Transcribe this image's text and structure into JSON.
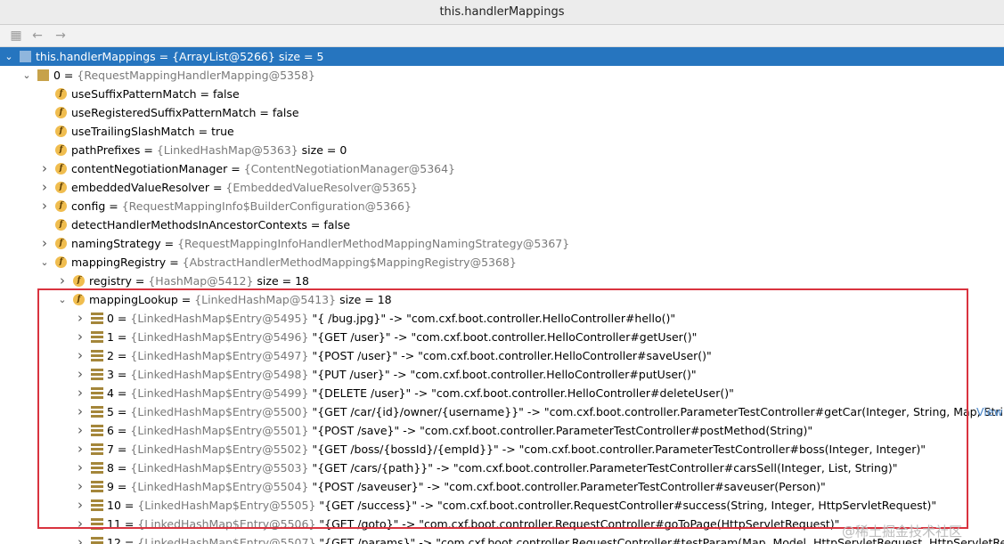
{
  "window_title": "this.handlerMappings",
  "toolbar": {
    "back_glyph": "←",
    "forward_glyph": "→"
  },
  "root": {
    "name": "this.handlerMappings",
    "value": "{ArrayList@5266}",
    "extra": "size = 5"
  },
  "item0": {
    "name": "0",
    "value": "{RequestMappingHandlerMapping@5358}"
  },
  "fields": [
    {
      "name": "useSuffixPatternMatch",
      "value": "false",
      "expandable": false,
      "plain": true
    },
    {
      "name": "useRegisteredSuffixPatternMatch",
      "value": "false",
      "expandable": false,
      "plain": true
    },
    {
      "name": "useTrailingSlashMatch",
      "value": "true",
      "expandable": false,
      "plain": true
    },
    {
      "name": "pathPrefixes",
      "value": "{LinkedHashMap@5363}",
      "extra": "size = 0",
      "expandable": false
    },
    {
      "name": "contentNegotiationManager",
      "value": "{ContentNegotiationManager@5364}",
      "expandable": true
    },
    {
      "name": "embeddedValueResolver",
      "value": "{EmbeddedValueResolver@5365}",
      "expandable": true
    },
    {
      "name": "config",
      "value": "{RequestMappingInfo$BuilderConfiguration@5366}",
      "expandable": true
    },
    {
      "name": "detectHandlerMethodsInAncestorContexts",
      "value": "false",
      "expandable": false,
      "plain": true
    },
    {
      "name": "namingStrategy",
      "value": "{RequestMappingInfoHandlerMethodMappingNamingStrategy@5367}",
      "expandable": true
    }
  ],
  "mappingRegistry": {
    "name": "mappingRegistry",
    "value": "{AbstractHandlerMethodMapping$MappingRegistry@5368}"
  },
  "registry": {
    "name": "registry",
    "value": "{HashMap@5412}",
    "extra": "size = 18"
  },
  "mappingLookup": {
    "name": "mappingLookup",
    "value": "{LinkedHashMap@5413}",
    "extra": "size = 18"
  },
  "entries": [
    {
      "idx": "0",
      "ref": "{LinkedHashMap$Entry@5495}",
      "text": "\"{ /bug.jpg}\" -> \"com.cxf.boot.controller.HelloController#hello()\""
    },
    {
      "idx": "1",
      "ref": "{LinkedHashMap$Entry@5496}",
      "text": "\"{GET /user}\" -> \"com.cxf.boot.controller.HelloController#getUser()\""
    },
    {
      "idx": "2",
      "ref": "{LinkedHashMap$Entry@5497}",
      "text": "\"{POST /user}\" -> \"com.cxf.boot.controller.HelloController#saveUser()\""
    },
    {
      "idx": "3",
      "ref": "{LinkedHashMap$Entry@5498}",
      "text": "\"{PUT /user}\" -> \"com.cxf.boot.controller.HelloController#putUser()\""
    },
    {
      "idx": "4",
      "ref": "{LinkedHashMap$Entry@5499}",
      "text": "\"{DELETE /user}\" -> \"com.cxf.boot.controller.HelloController#deleteUser()\""
    },
    {
      "idx": "5",
      "ref": "{LinkedHashMap$Entry@5500}",
      "text": "\"{GET /car/{id}/owner/{username}}\" -> \"com.cxf.boot.controller.ParameterTestController#getCar(Integer, String, Map, String, Map,...",
      "link": "View"
    },
    {
      "idx": "6",
      "ref": "{LinkedHashMap$Entry@5501}",
      "text": "\"{POST /save}\" -> \"com.cxf.boot.controller.ParameterTestController#postMethod(String)\""
    },
    {
      "idx": "7",
      "ref": "{LinkedHashMap$Entry@5502}",
      "text": "\"{GET /boss/{bossId}/{empId}}\" -> \"com.cxf.boot.controller.ParameterTestController#boss(Integer, Integer)\""
    },
    {
      "idx": "8",
      "ref": "{LinkedHashMap$Entry@5503}",
      "text": "\"{GET /cars/{path}}\" -> \"com.cxf.boot.controller.ParameterTestController#carsSell(Integer, List, String)\""
    },
    {
      "idx": "9",
      "ref": "{LinkedHashMap$Entry@5504}",
      "text": "\"{POST /saveuser}\" -> \"com.cxf.boot.controller.ParameterTestController#saveuser(Person)\""
    },
    {
      "idx": "10",
      "ref": "{LinkedHashMap$Entry@5505}",
      "text": "\"{GET /success}\" -> \"com.cxf.boot.controller.RequestController#success(String, Integer, HttpServletRequest)\""
    },
    {
      "idx": "11",
      "ref": "{LinkedHashMap$Entry@5506}",
      "text": "\"{GET /goto}\" -> \"com.cxf.boot.controller.RequestController#goToPage(HttpServletRequest)\""
    },
    {
      "idx": "12",
      "ref": "{LinkedHashMap$Entry@5507}",
      "text": "\"{GET /params}\" -> \"com.cxf.boot.controller.RequestController#testParam(Map, Model, HttpServletRequest, HttpServletResponse)\""
    }
  ],
  "watermark": "@稀土掘金技术社区"
}
